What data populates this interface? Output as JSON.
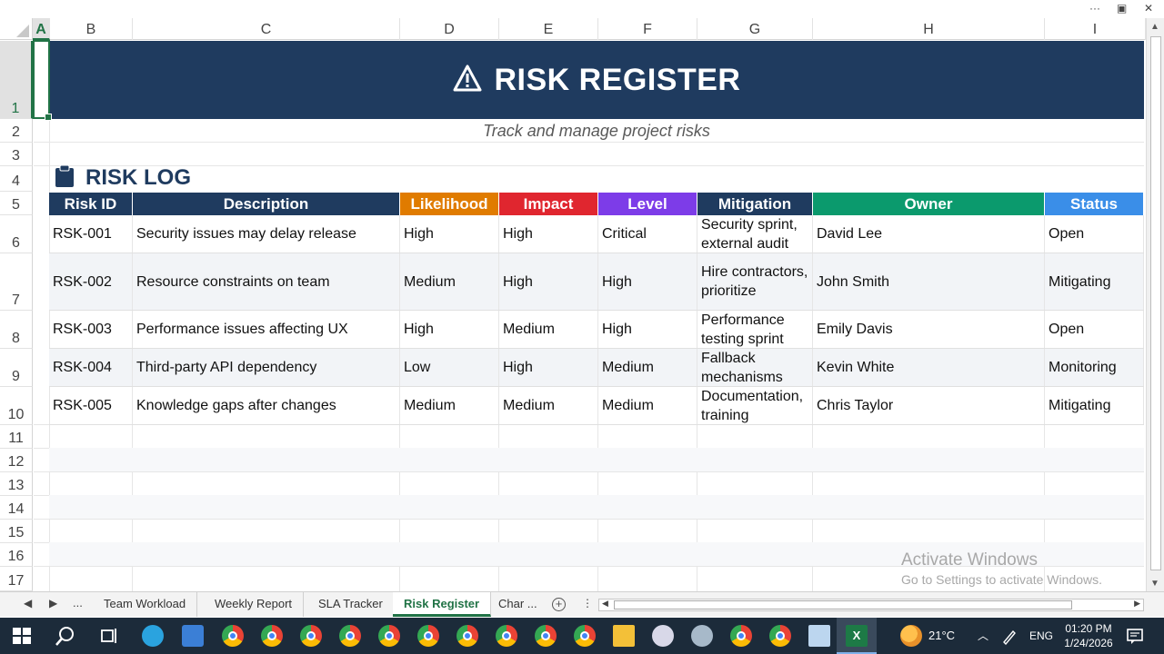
{
  "window": {
    "controls": [
      "···",
      "▣",
      "✕"
    ]
  },
  "columns": [
    "A",
    "B",
    "C",
    "D",
    "E",
    "F",
    "G",
    "H",
    "I"
  ],
  "rows": [
    "1",
    "2",
    "3",
    "4",
    "5",
    "6",
    "7",
    "8",
    "9",
    "10",
    "11",
    "12",
    "13",
    "14",
    "15",
    "16",
    "17"
  ],
  "banner": {
    "icon": "warning-triangle-icon",
    "title": "RISK REGISTER"
  },
  "subtitle": "Track and manage project risks",
  "section": {
    "icon": "clipboard-icon",
    "title": "RISK LOG"
  },
  "table": {
    "headers": [
      {
        "label": "Risk ID",
        "color": "#1f3b5f"
      },
      {
        "label": "Description",
        "color": "#1f3b5f"
      },
      {
        "label": "Likelihood",
        "color": "#e07b00"
      },
      {
        "label": "Impact",
        "color": "#e0262f"
      },
      {
        "label": "Level",
        "color": "#7d3ce8"
      },
      {
        "label": "Mitigation",
        "color": "#1f3b5f"
      },
      {
        "label": "Owner",
        "color": "#0b9a6d"
      },
      {
        "label": "Status",
        "color": "#3a8ee8"
      }
    ],
    "rows": [
      [
        "RSK-001",
        "Security issues may delay release",
        "High",
        "High",
        "Critical",
        "Security sprint, external audit",
        "David Lee",
        "Open"
      ],
      [
        "RSK-002",
        "Resource constraints on team",
        "Medium",
        "High",
        "High",
        "Hire contractors, prioritize",
        "John Smith",
        "Mitigating"
      ],
      [
        "RSK-003",
        "Performance issues affecting UX",
        "High",
        "Medium",
        "High",
        "Performance testing sprint",
        "Emily Davis",
        "Open"
      ],
      [
        "RSK-004",
        "Third-party API dependency",
        "Low",
        "High",
        "Medium",
        "Fallback mechanisms",
        "Kevin White",
        "Monitoring"
      ],
      [
        "RSK-005",
        "Knowledge gaps after changes",
        "Medium",
        "Medium",
        "Medium",
        "Documentation, training",
        "Chris Taylor",
        "Mitigating"
      ]
    ]
  },
  "watermark": {
    "line1": "Activate Windows",
    "line2": "Go to Settings to activate Windows."
  },
  "sheets": {
    "nav_prev": "◀",
    "nav_next": "▶",
    "more": "...",
    "tabs": [
      "Team Workload",
      "Weekly Report",
      "SLA Tracker",
      "Risk Register",
      "Char ..."
    ],
    "active": "Risk Register",
    "add": "+",
    "options": "⋮"
  },
  "taskbar": {
    "weather": "21°C",
    "language": "ENG",
    "time": "01:20 PM",
    "date": "1/24/2026"
  }
}
